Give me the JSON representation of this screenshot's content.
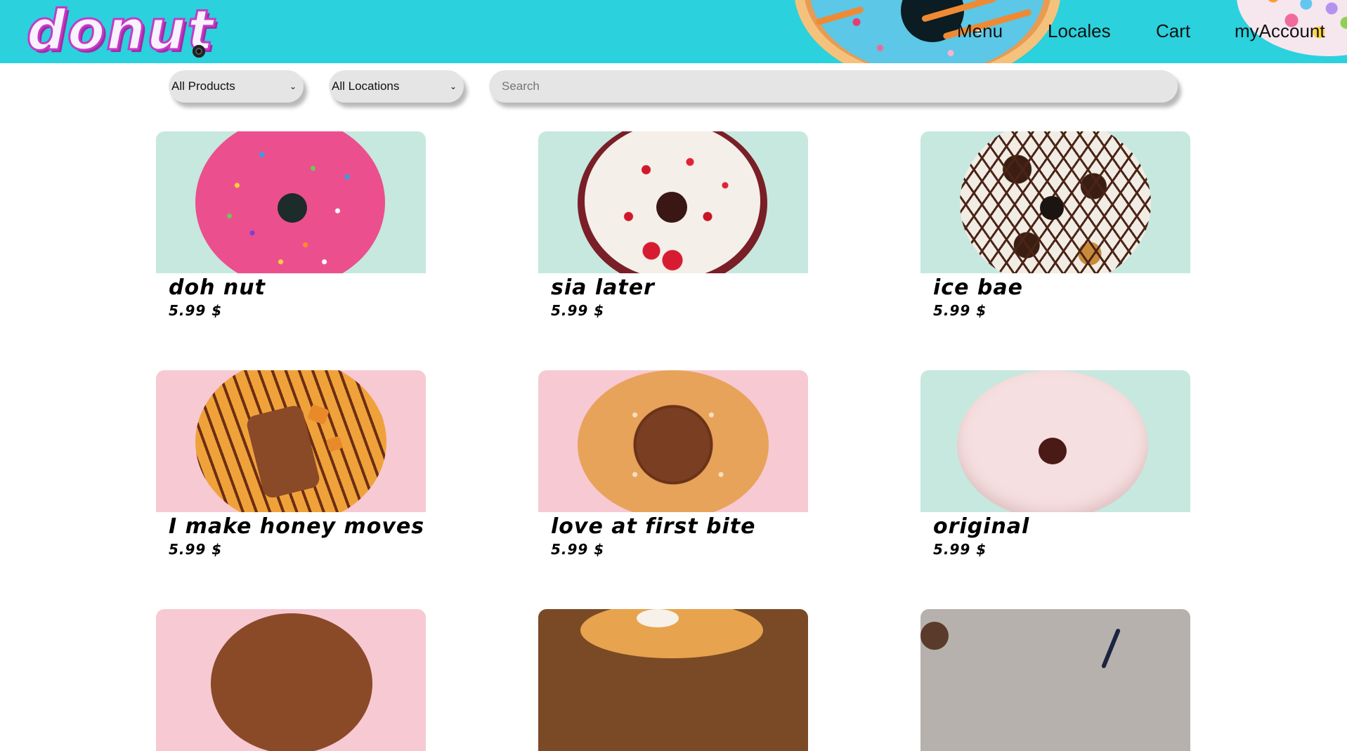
{
  "header": {
    "logo_text": "donut",
    "nav": [
      "Menu",
      "Locales",
      "Cart",
      "myAccount"
    ]
  },
  "filters": {
    "products": {
      "selected": "All Products",
      "options": [
        "All Products"
      ]
    },
    "locations": {
      "selected": "All Locations",
      "options": [
        "All Locations"
      ]
    },
    "search_placeholder": "Search"
  },
  "products": [
    {
      "name": "doh nut",
      "price": "5.99 $"
    },
    {
      "name": "sia later",
      "price": "5.99 $"
    },
    {
      "name": "ice bae",
      "price": "5.99 $"
    },
    {
      "name": "I make honey moves",
      "price": "5.99 $"
    },
    {
      "name": "love at first bite",
      "price": "5.99 $"
    },
    {
      "name": "original",
      "price": "5.99 $"
    }
  ],
  "colors": {
    "header_bg": "#2bd1dd",
    "mint_bg": "#c6e8df",
    "pink_bg": "#f7c9d3",
    "input_bg": "#e5e5e5"
  }
}
